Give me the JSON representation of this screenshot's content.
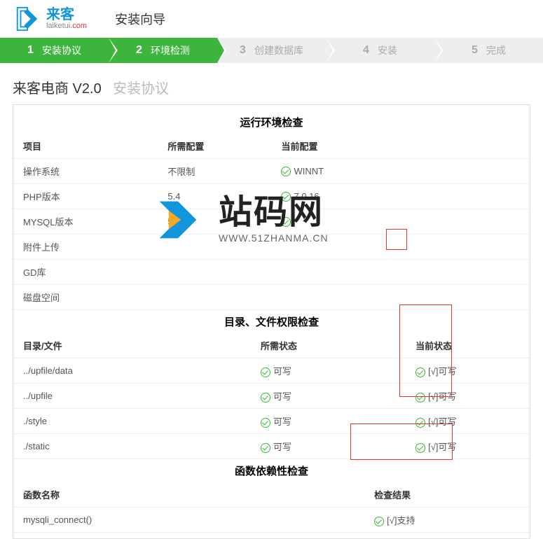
{
  "header": {
    "logo_cn": "来客",
    "logo_en_pre": "laiketui",
    "logo_en_suf": ".com",
    "title": "安装向导"
  },
  "steps": [
    {
      "num": "1",
      "label": "安装协议",
      "active": true
    },
    {
      "num": "2",
      "label": "环境检测",
      "active": true
    },
    {
      "num": "3",
      "label": "创建数据库",
      "active": false
    },
    {
      "num": "4",
      "label": "安装",
      "active": false
    },
    {
      "num": "5",
      "label": "完成",
      "active": false
    }
  ],
  "page": {
    "main": "来客电商 V2.0",
    "sub": "安装协议"
  },
  "env": {
    "title": "运行环境检查",
    "headers": [
      "项目",
      "所需配置",
      "当前配置"
    ],
    "rows": [
      {
        "item": "操作系统",
        "req": "不限制",
        "cur": "WINNT"
      },
      {
        "item": "PHP版本",
        "req": "5.4",
        "cur": "7.0.16"
      },
      {
        "item": "MYSQL版本",
        "req": "5.5",
        "cur": ""
      },
      {
        "item": "附件上传",
        "req": "",
        "cur": ""
      },
      {
        "item": "GD库",
        "req": "",
        "cur": ""
      },
      {
        "item": "磁盘空间",
        "req": "",
        "cur": ""
      }
    ]
  },
  "dir": {
    "title": "目录、文件权限检查",
    "headers": [
      "目录/文件",
      "所需状态",
      "当前状态"
    ],
    "rows": [
      {
        "path": "../upfile/data",
        "req": "可写",
        "cur": "[√]可写"
      },
      {
        "path": "../upfile",
        "req": "可写",
        "cur": "[√]可写"
      },
      {
        "path": "./style",
        "req": "可写",
        "cur": "[√]可写"
      },
      {
        "path": "./static",
        "req": "可写",
        "cur": "[√]可写"
      }
    ]
  },
  "func": {
    "title": "函数依赖性检查",
    "headers": [
      "函数名称",
      "检查结果"
    ],
    "rows": [
      {
        "name": "mysqli_connect()",
        "result": "[√]支持"
      }
    ]
  },
  "watermark": {
    "cn": "站码网",
    "en": "WWW.51ZHANMA.CN"
  }
}
